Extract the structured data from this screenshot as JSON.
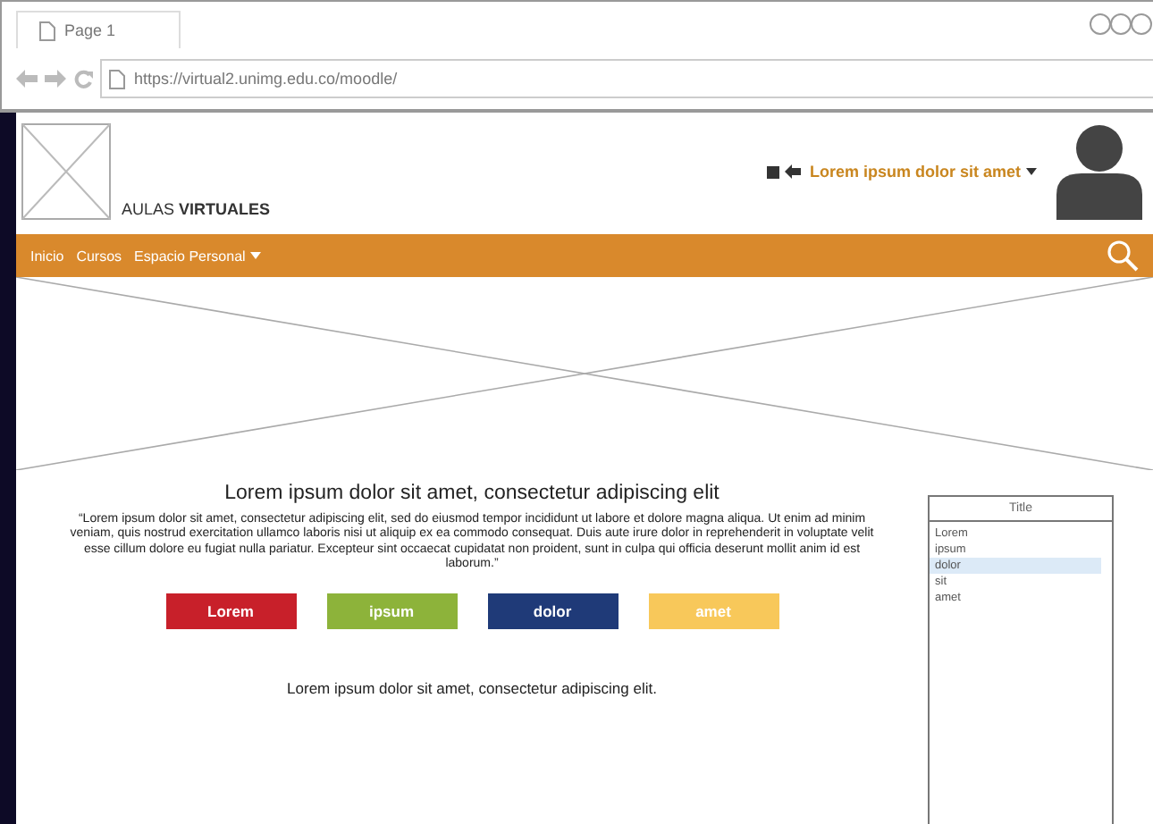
{
  "browser": {
    "tab": {
      "label": "Page 1"
    },
    "url": "https://virtual2.unimg.edu.co/moodle/"
  },
  "header": {
    "brand": {
      "light": "AULAS",
      "bold": "VIRTUALES"
    },
    "user_menu": "Lorem ipsum dolor sit amet"
  },
  "nav": {
    "items": [
      {
        "label": "Inicio",
        "dropdown": false
      },
      {
        "label": "Cursos",
        "dropdown": false
      },
      {
        "label": "Espacio Personal",
        "dropdown": true
      }
    ]
  },
  "content": {
    "heading": "Lorem ipsum dolor sit amet, consectetur adipiscing elit",
    "paragraph": "“Lorem ipsum dolor sit amet, consectetur adipiscing elit, sed do eiusmod tempor incididunt ut labore et dolore magna aliqua. Ut enim ad minim veniam, quis nostrud exercitation ullamco laboris nisi ut aliquip ex ea commodo consequat. Duis aute irure dolor in reprehenderit in voluptate velit esse cillum dolore eu fugiat nulla pariatur. Excepteur sint occaecat cupidatat non proident, sunt in culpa qui officia deserunt mollit anim id est laborum.”",
    "buttons": [
      {
        "label": "Lorem",
        "color": "#c8202a"
      },
      {
        "label": "ipsum",
        "color": "#8db33a"
      },
      {
        "label": "dolor",
        "color": "#1f3a78"
      },
      {
        "label": "amet",
        "color": "#f8c85a"
      }
    ],
    "footer_text": "Lorem ipsum dolor sit amet, consectetur adipiscing elit."
  },
  "side_list": {
    "title": "Title",
    "items": [
      {
        "label": "Lorem",
        "selected": false
      },
      {
        "label": "ipsum",
        "selected": false
      },
      {
        "label": "dolor",
        "selected": true
      },
      {
        "label": "sit",
        "selected": false
      },
      {
        "label": "amet",
        "selected": false
      }
    ]
  }
}
